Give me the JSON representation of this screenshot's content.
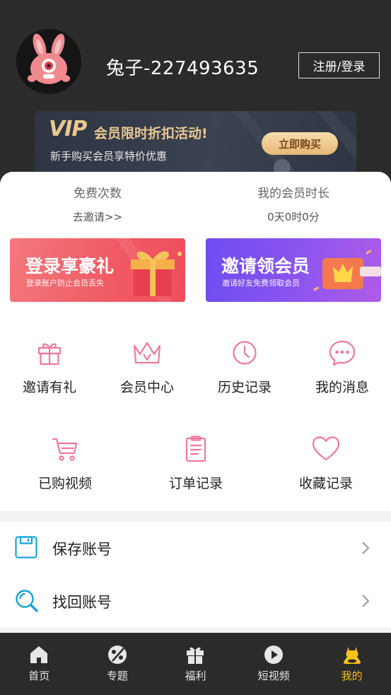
{
  "header": {
    "username": "兔子-227493635",
    "login_label": "注册/登录"
  },
  "vip_banner": {
    "logo": "VIP",
    "title": "会员限时折扣活动!",
    "subtitle": "新手购买会员享特价优惠",
    "buy_label": "立即购买"
  },
  "stats": [
    {
      "title": "免费次数",
      "value": "去邀请>>"
    },
    {
      "title": "我的会员时长",
      "value": "0天0时0分"
    }
  ],
  "promos": {
    "login": {
      "title": "登录享豪礼",
      "subtitle": "登录账户防止会员丢失"
    },
    "invite": {
      "title": "邀请领会员",
      "subtitle": "邀请好友免费领取会员"
    }
  },
  "grid_row1": [
    {
      "label": "邀请有礼",
      "icon": "gift-icon"
    },
    {
      "label": "会员中心",
      "icon": "crown-icon"
    },
    {
      "label": "历史记录",
      "icon": "clock-icon"
    },
    {
      "label": "我的消息",
      "icon": "message-icon"
    }
  ],
  "grid_row2": [
    {
      "label": "已购视频",
      "icon": "cart-icon"
    },
    {
      "label": "订单记录",
      "icon": "clipboard-icon"
    },
    {
      "label": "收藏记录",
      "icon": "heart-icon"
    }
  ],
  "list": [
    {
      "label": "保存账号",
      "icon": "floppy-disk-icon"
    },
    {
      "label": "找回账号",
      "icon": "magnifier-icon"
    }
  ],
  "bottom_nav": [
    {
      "label": "首页",
      "icon": "home-icon"
    },
    {
      "label": "专题",
      "icon": "topic-icon"
    },
    {
      "label": "福利",
      "icon": "gift-icon"
    },
    {
      "label": "短视频",
      "icon": "play-icon"
    },
    {
      "label": "我的",
      "icon": "user-icon",
      "active": true
    }
  ],
  "colors": {
    "accent_pink": "#f0799a",
    "accent_blue": "#1aa3d8",
    "nav_active": "#f6c21a",
    "header_bg": "#2b2b2b"
  }
}
